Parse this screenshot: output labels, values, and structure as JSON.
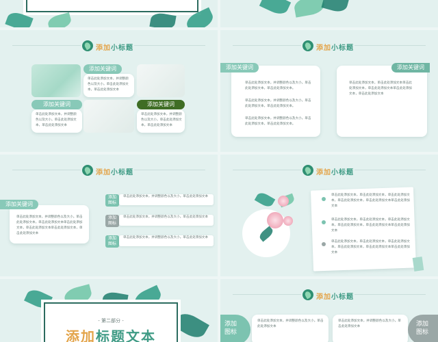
{
  "slides": {
    "s1": {},
    "s2": {},
    "s3": {
      "section_title_a": "添加",
      "section_title_b": "小标题",
      "pill_1": "添加关键词",
      "pill_2": "添加关键词",
      "pill_3": "添加关键词",
      "card_text": "单击此处添加文本，并调整颜色以及大小。单击此处添加文本，单击此处添加文本"
    },
    "s4": {
      "section_title_a": "添加",
      "section_title_b": "小标题",
      "pill_left": "添加关键词",
      "pill_right": "添加关键词",
      "card_line_1": "单击此处添加文本，并调整颜色以及大小。单击此处添加文本，单击此处添加文本。",
      "card_line_right": "单击此处添加文本，单击此处添加文本单击此处添加文本，单击此处添加文本单击此处添加文本，单击此处添加文本"
    },
    "s5": {
      "section_title_a": "添加",
      "section_title_b": "小标题",
      "pill": "添加关键词",
      "left_text": "单击此处添加文本，并调整颜色以及大小。单击此处添加文本，单击此处添加文本单击此处添加文本，单击此处添加文本单击此处添加文本，单击此处添加文本",
      "items": [
        {
          "label": "添加\n图标",
          "text": "单击此处添加文本，并调整颜色以及大小。单击此处添加文本",
          "color": "#7cc3b0"
        },
        {
          "label": "添加\n图标",
          "text": "单击此处添加文本，并调整颜色以及大小。单击此处添加文本",
          "color": "#9aa7a6"
        },
        {
          "label": "添加\n图标",
          "text": "单击此处添加文本，并调整颜色以及大小。单击此处添加文本",
          "color": "#7cc3b0"
        }
      ]
    },
    "s6": {
      "section_title_a": "添加",
      "section_title_b": "小标题",
      "bullet_text": "单击此处添加文本，单击此处添加文本，单击此处添加文本，单击此处添加文本，单击此处添加文本单击此处添加文本",
      "dot_colors": [
        "#7cc3b0",
        "#7cc3b0",
        "#9aa7a6"
      ]
    },
    "s7": {
      "part_label": "- 第二部分 -",
      "big_title_a": "添加",
      "big_title_b": "标题文本"
    },
    "s8": {
      "section_title_a": "添加",
      "section_title_b": "小标题",
      "label_left": "添加\n图标",
      "label_right": "添加\n图标",
      "text": "单击此处添加文本，并调整颜色以及大小。单击此处添加文本"
    }
  },
  "colors": {
    "accent_green": "#3f9b85",
    "accent_orange": "#e3a44a",
    "dark_green_pill": "#3f6d24",
    "slide_bg": "#e3f1ef"
  }
}
